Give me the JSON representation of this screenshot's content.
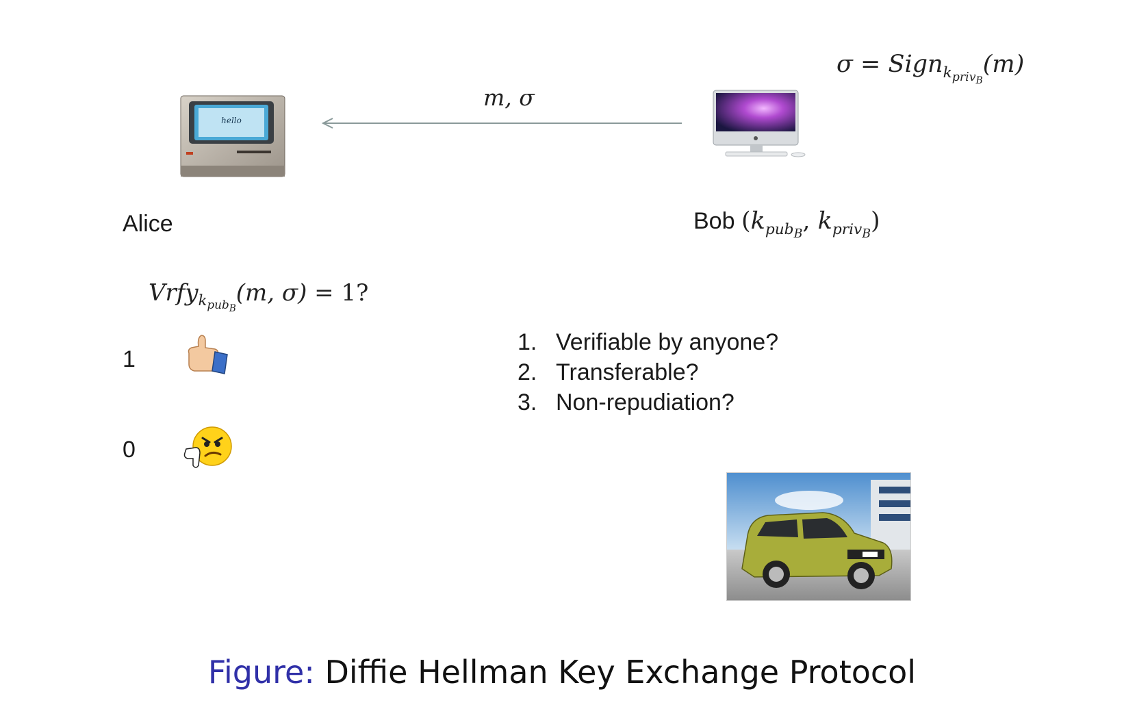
{
  "sign_formula": {
    "sigma": "σ",
    "eq": " = ",
    "sign": "Sign",
    "k": "k",
    "priv": "priv",
    "B": "B",
    "arg": "(m)"
  },
  "message_label": "m, σ",
  "alice": {
    "label": "Alice"
  },
  "bob": {
    "label": "Bob",
    "open": "(",
    "k1": "k",
    "pub": "pub",
    "B1": "B",
    "comma": ", ",
    "k2": "k",
    "priv": "priv",
    "B2": "B",
    "close": ")"
  },
  "verify_formula": {
    "vrfy": "Vrfy",
    "k": "k",
    "pub": "pub",
    "B": "B",
    "args": "(m, σ)",
    "rest": " = 1?"
  },
  "outcomes": {
    "one": "1",
    "zero": "0"
  },
  "questions": [
    {
      "n": "1.",
      "text": "Verifiable by anyone?"
    },
    {
      "n": "2.",
      "text": "Transferable?"
    },
    {
      "n": "3.",
      "text": "Non-repudiation?"
    }
  ],
  "caption": {
    "prefix": "Figure:",
    "text": " Diffie Hellman Key Exchange Protocol"
  },
  "colors": {
    "caption_prefix": "#3030a8",
    "arrow": "#8a9a9a",
    "car": "#a8ad3a"
  },
  "icons": [
    "old-macintosh-icon",
    "imac-icon",
    "thumbs-up-icon",
    "thumbs-down-angry-face-icon",
    "car-photo"
  ]
}
